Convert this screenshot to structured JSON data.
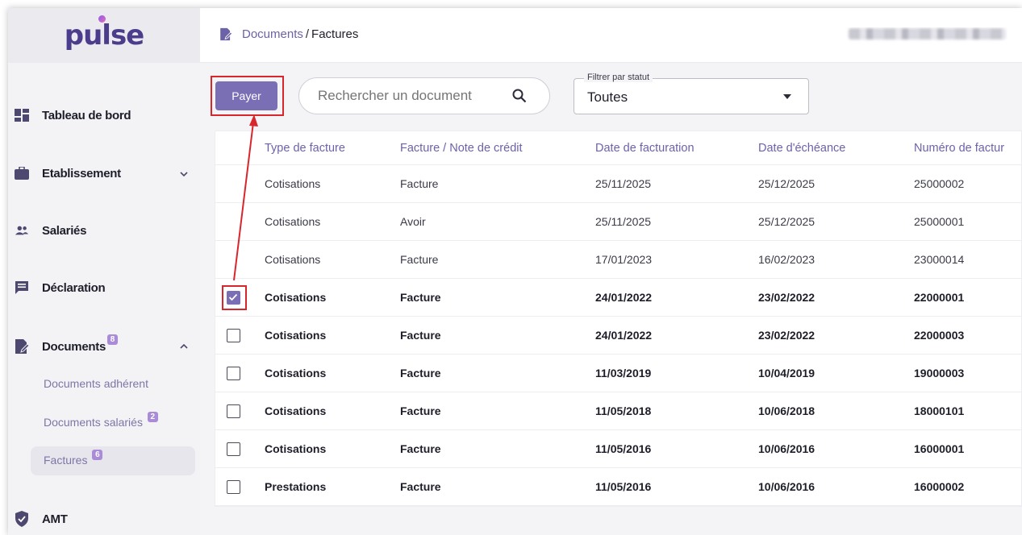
{
  "brand": {
    "logo_text": "pulse"
  },
  "sidebar": {
    "items": [
      {
        "label": "Tableau de bord",
        "icon": "dashboard-icon"
      },
      {
        "label": "Etablissement",
        "icon": "briefcase-icon",
        "expandable": true
      },
      {
        "label": "Salariés",
        "icon": "people-icon"
      },
      {
        "label": "Déclaration",
        "icon": "message-icon"
      },
      {
        "label": "Documents",
        "icon": "document-icon",
        "badge": "8",
        "expanded": true
      },
      {
        "label": "AMT",
        "icon": "shield-icon"
      }
    ],
    "subitems": [
      {
        "label": "Documents adhérent"
      },
      {
        "label": "Documents salariés",
        "badge": "2"
      },
      {
        "label": "Factures",
        "badge": "6",
        "active": true
      }
    ]
  },
  "breadcrumb": {
    "section": "Documents",
    "separator": "/",
    "page": "Factures"
  },
  "toolbar": {
    "pay_label": "Payer",
    "search_placeholder": "Rechercher un document",
    "filter_label": "Filtrer par statut",
    "filter_value": "Toutes"
  },
  "table": {
    "columns": [
      "Type de facture",
      "Facture / Note de crédit",
      "Date de facturation",
      "Date d'échéance",
      "Numéro de factur"
    ],
    "rows": [
      {
        "checkbox": false,
        "bold": false,
        "cells": [
          "Cotisations",
          "Facture",
          "25/11/2025",
          "25/12/2025",
          "25000002"
        ]
      },
      {
        "checkbox": false,
        "bold": false,
        "cells": [
          "Cotisations",
          "Avoir",
          "25/11/2025",
          "25/12/2025",
          "25000001"
        ]
      },
      {
        "checkbox": false,
        "bold": false,
        "cells": [
          "Cotisations",
          "Facture",
          "17/01/2023",
          "16/02/2023",
          "23000014"
        ]
      },
      {
        "checkbox": true,
        "checked": true,
        "bold": true,
        "cells": [
          "Cotisations",
          "Facture",
          "24/01/2022",
          "23/02/2022",
          "22000001"
        ]
      },
      {
        "checkbox": true,
        "checked": false,
        "bold": true,
        "cells": [
          "Cotisations",
          "Facture",
          "24/01/2022",
          "23/02/2022",
          "22000003"
        ]
      },
      {
        "checkbox": true,
        "checked": false,
        "bold": true,
        "cells": [
          "Cotisations",
          "Facture",
          "11/03/2019",
          "10/04/2019",
          "19000003"
        ]
      },
      {
        "checkbox": true,
        "checked": false,
        "bold": true,
        "cells": [
          "Cotisations",
          "Facture",
          "11/05/2018",
          "10/06/2018",
          "18000101"
        ]
      },
      {
        "checkbox": true,
        "checked": false,
        "bold": true,
        "cells": [
          "Cotisations",
          "Facture",
          "11/05/2016",
          "10/06/2016",
          "16000001"
        ]
      },
      {
        "checkbox": true,
        "checked": false,
        "bold": true,
        "cells": [
          "Prestations",
          "Facture",
          "11/05/2016",
          "10/06/2016",
          "16000002"
        ]
      }
    ]
  },
  "colors": {
    "accent": "#7a6eb5",
    "brand": "#4c3c8c",
    "highlight": "#d8262d",
    "badge": "#a98bd8"
  }
}
